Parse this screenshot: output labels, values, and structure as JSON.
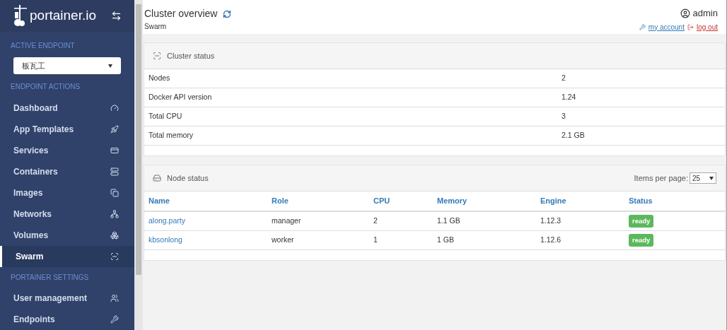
{
  "sidebar": {
    "logo": "portainer.io",
    "active_endpoint_label": "ACTIVE ENDPOINT",
    "endpoint_select": {
      "value": "板瓦工"
    },
    "sections": [
      {
        "title": "ENDPOINT ACTIONS",
        "items": [
          {
            "label": "Dashboard",
            "selected": false
          },
          {
            "label": "App Templates",
            "selected": false
          },
          {
            "label": "Services",
            "selected": false
          },
          {
            "label": "Containers",
            "selected": false
          },
          {
            "label": "Images",
            "selected": false
          },
          {
            "label": "Networks",
            "selected": false
          },
          {
            "label": "Volumes",
            "selected": false
          },
          {
            "label": "Swarm",
            "selected": true
          }
        ]
      },
      {
        "title": "PORTAINER SETTINGS",
        "items": [
          {
            "label": "User management",
            "selected": false
          },
          {
            "label": "Endpoints",
            "selected": false
          }
        ]
      }
    ]
  },
  "header": {
    "title": "Cluster overview",
    "subtitle": "Swarm",
    "user": "admin",
    "my_account": "my account",
    "log_out": "log out"
  },
  "cluster_status": {
    "title": "Cluster status",
    "rows": [
      {
        "label": "Nodes",
        "value": "2"
      },
      {
        "label": "Docker API version",
        "value": "1.24"
      },
      {
        "label": "Total CPU",
        "value": "3"
      },
      {
        "label": "Total memory",
        "value": "2.1 GB"
      }
    ]
  },
  "node_status": {
    "title": "Node status",
    "items_per_page_label": "Items per page:",
    "items_per_page": "25",
    "columns": [
      "Name",
      "Role",
      "CPU",
      "Memory",
      "Engine",
      "Status"
    ],
    "rows": [
      {
        "name": "along.party",
        "role": "manager",
        "cpu": "2",
        "memory": "1.1 GB",
        "engine": "1.12.3",
        "status": "ready"
      },
      {
        "name": "kbsonlong",
        "role": "worker",
        "cpu": "1",
        "memory": "1 GB",
        "engine": "1.12.6",
        "status": "ready"
      }
    ]
  }
}
